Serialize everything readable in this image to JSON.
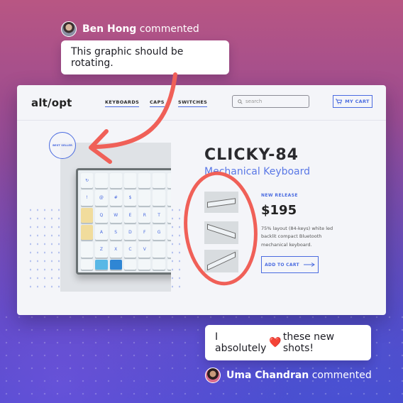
{
  "comments": {
    "first": {
      "author": "Ben Hong",
      "action": "commented",
      "text": "This graphic should be rotating."
    },
    "second": {
      "author": "Uma Chandran",
      "action": "commented",
      "text_before": "I absolutely",
      "heart": "❤️",
      "text_after": "these new shots!"
    }
  },
  "site": {
    "logo": "alt/opt",
    "nav": [
      "KEYBOARDS",
      "CAPS",
      "SWITCHES"
    ],
    "search_placeholder": "search",
    "cart_label": "MY CART",
    "badge_text": "BEST SELLER",
    "product": {
      "name": "CLICKY-84",
      "type": "Mechanical Keyboard",
      "tag": "NEW RELEASE",
      "price": "$195",
      "description": "75% layout (84-keys) white led backlit compact Bluetooth mechanical keyboard.",
      "cta": "ADD TO CART"
    }
  },
  "colors": {
    "accent": "#4a6be0",
    "annotation": "#f06058"
  }
}
